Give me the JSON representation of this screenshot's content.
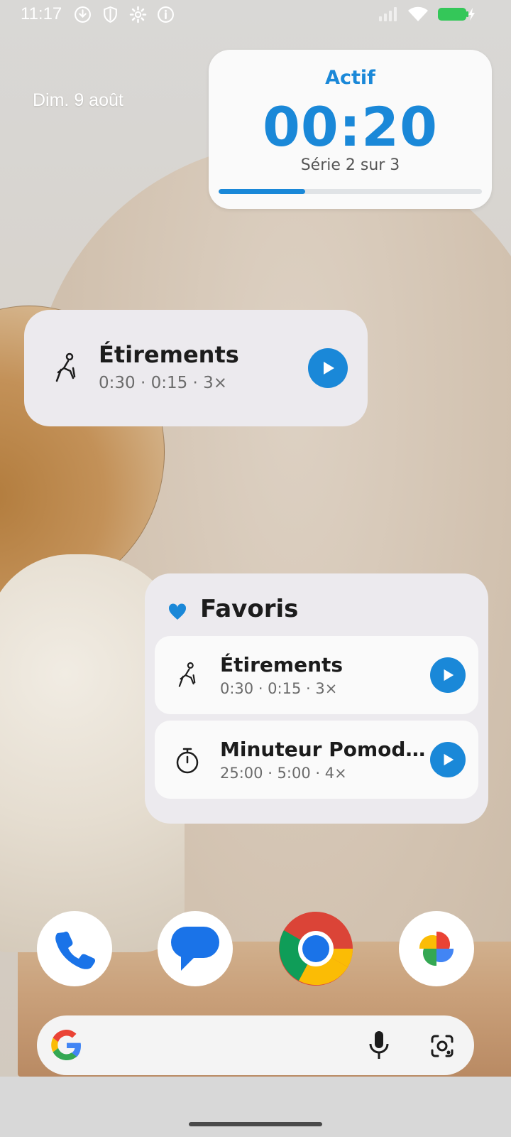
{
  "status_bar": {
    "time": "11:17",
    "icons": [
      "download-icon",
      "shield-icon",
      "settings-icon",
      "info-icon",
      "signal-icon",
      "wifi-icon",
      "battery-charging-icon"
    ]
  },
  "date": "Dim. 9 août",
  "active_timer": {
    "status": "Actif",
    "time": "00:20",
    "set_label": "Série 2 sur 3",
    "progress": 0.33,
    "accent_color": "#1a88d8"
  },
  "single_widget": {
    "icon": "stretching-icon",
    "title": "Étirements",
    "meta": "0:30 · 0:15 · 3×"
  },
  "favorites": {
    "icon": "heart-icon",
    "title": "Favoris",
    "items": [
      {
        "icon": "stretching-icon",
        "title": "Étirements",
        "meta": "0:30 · 0:15 · 3×"
      },
      {
        "icon": "stopwatch-icon",
        "title": "Minuteur Pomodoro",
        "meta": "25:00 · 5:00 · 4×"
      }
    ]
  },
  "dock": {
    "apps": [
      "phone-icon",
      "messages-icon",
      "chrome-icon",
      "photos-icon"
    ]
  },
  "search_bar": {
    "icons": [
      "google-icon",
      "microphone-icon",
      "lens-icon"
    ]
  }
}
